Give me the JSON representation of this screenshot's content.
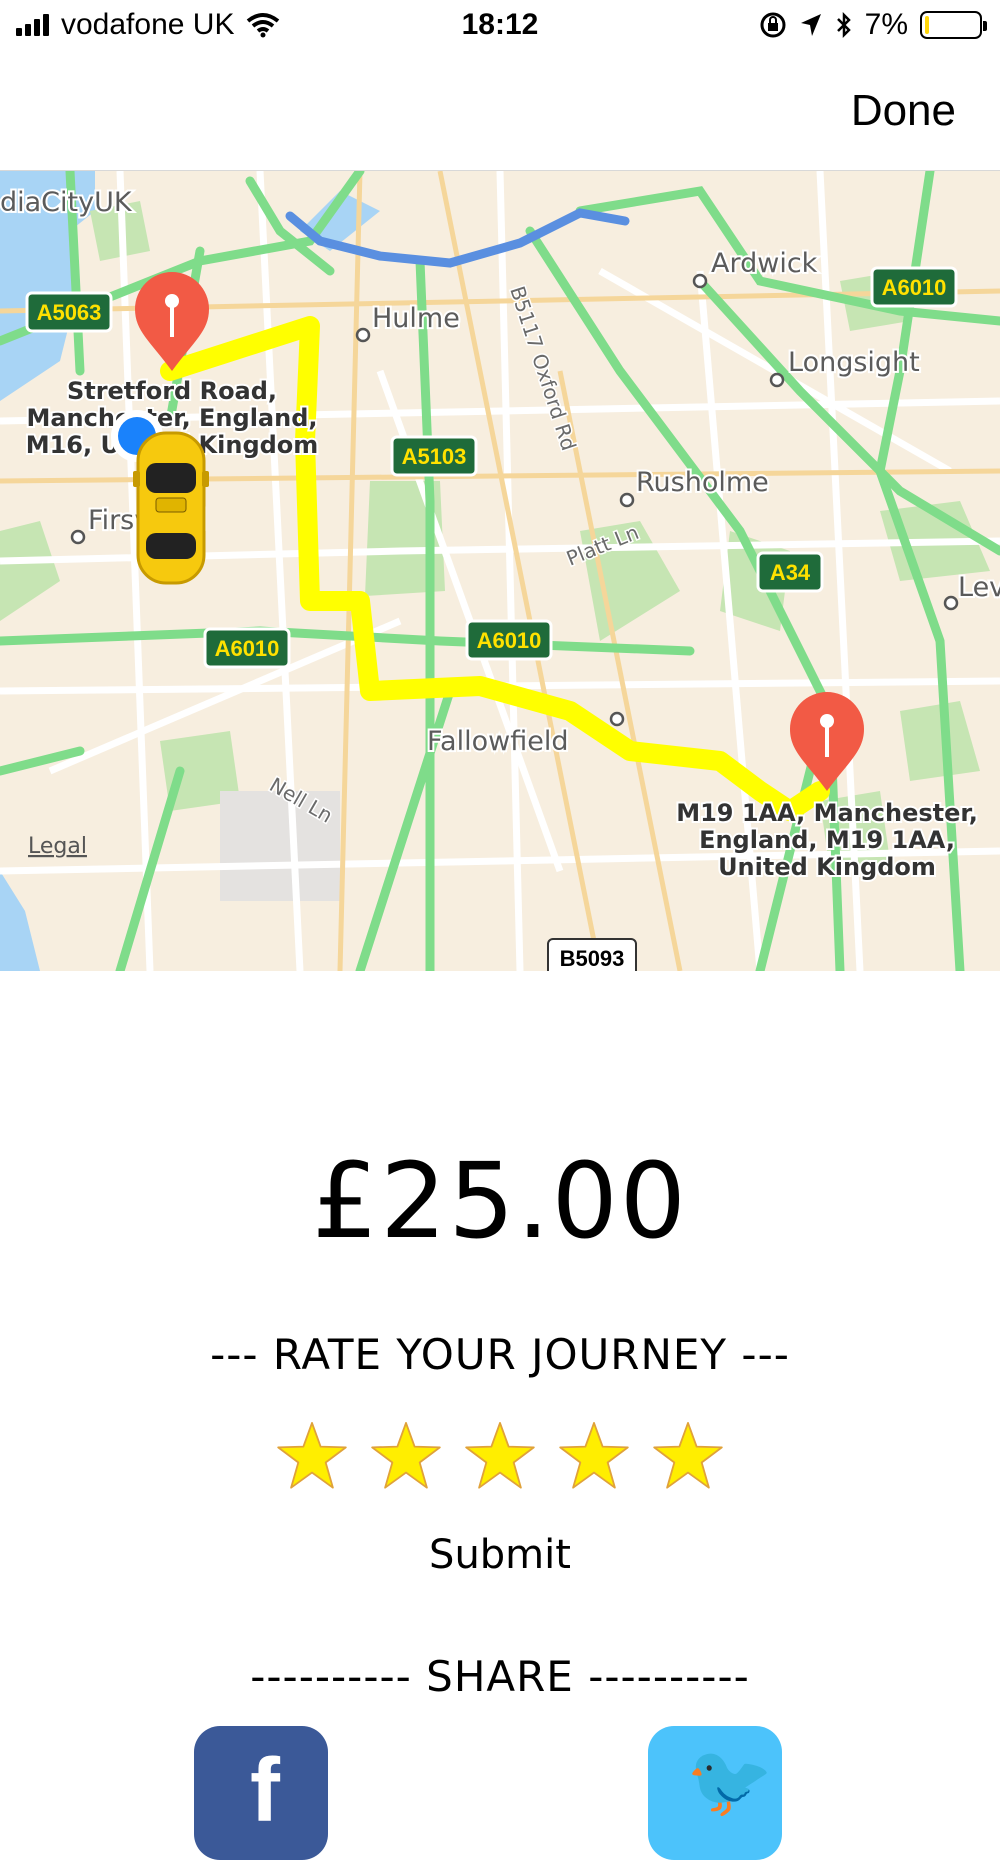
{
  "status_bar": {
    "carrier": "vodafone UK",
    "time": "18:12",
    "battery_text": "7%",
    "battery_level": 0.07,
    "icons": [
      "signal-icon",
      "wifi-icon",
      "orientation-lock-icon",
      "location-arrow-icon",
      "bluetooth-icon",
      "battery-icon"
    ]
  },
  "nav": {
    "done_label": "Done"
  },
  "map": {
    "labels": {
      "mediacity": "diaCityUK",
      "hulme": "Hulme",
      "ardwick": "Ardwick",
      "longsight": "Longsight",
      "rusholme": "Rusholme",
      "firswood": "Firswood",
      "fallowfield": "Fallowfield",
      "oxford_rd": "B5117   Oxford Rd",
      "platt_ln": "Platt Ln",
      "nell_ln": "Nell Ln",
      "levenshulme": "Lev",
      "legal": "Legal"
    },
    "road_shields": {
      "a5063": "A5063",
      "a6010_ne": "A6010",
      "a5103": "A5103",
      "a34": "A34",
      "a6010_w": "A6010",
      "a6010_c": "A6010",
      "b5093": "B5093"
    },
    "pickup_address": [
      "Stretford Road,",
      "Manchester, England,",
      "M16, United Kingdom"
    ],
    "dropoff_address": [
      "M19 1AA, Manchester,",
      "England, M19 1AA,",
      "United Kingdom"
    ],
    "colors": {
      "route": "#ffff00",
      "traffic": "#5a8fe0",
      "main_road": "#7fdc8a",
      "pin": "#f25a45",
      "user_dot": "#1a82fb"
    }
  },
  "fare": "£25.00",
  "rating": {
    "title": "--- RATE YOUR JOURNEY ---",
    "stars": 5,
    "max": 5,
    "star_color": "#ffee00"
  },
  "submit_label": "Submit",
  "share": {
    "title": "---------- SHARE ----------",
    "facebook_glyph": "f",
    "twitter_glyph": "🐦"
  }
}
